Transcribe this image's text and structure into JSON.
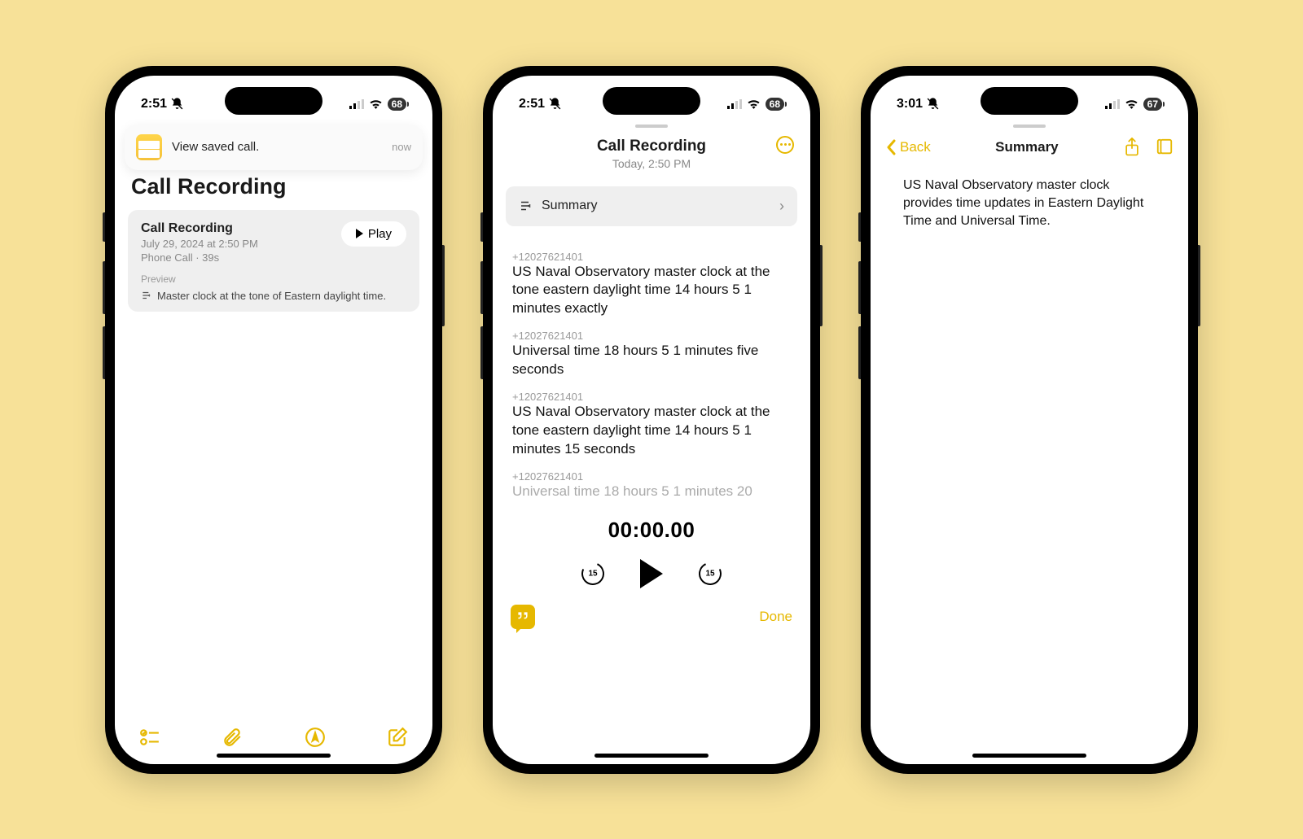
{
  "phone1": {
    "status": {
      "time": "2:51",
      "battery": "68"
    },
    "notification": {
      "text": "View saved call.",
      "time": "now"
    },
    "header": "Call Recording",
    "card": {
      "title": "Call Recording",
      "date": "July 29, 2024 at 2:50 PM",
      "details": "Phone Call · 39s",
      "play_label": "Play",
      "preview_label": "Preview",
      "preview_text": "Master clock at the tone of Eastern daylight time."
    }
  },
  "phone2": {
    "status": {
      "time": "2:51",
      "battery": "68"
    },
    "title": "Call Recording",
    "subtitle": "Today, 2:50 PM",
    "summary_label": "Summary",
    "caller_number": "+12027621401",
    "transcript": [
      {
        "text": "US Naval Observatory master clock at the tone eastern daylight time 14 hours 5 1 minutes exactly"
      },
      {
        "text": "Universal time 18 hours 5 1 minutes five seconds"
      },
      {
        "text": "US Naval Observatory master clock at the tone eastern daylight time 14 hours 5 1 minutes 15 seconds"
      },
      {
        "text": "Universal time 18 hours 5 1 minutes 20"
      }
    ],
    "player_time": "00:00.00",
    "skip_seconds": "15",
    "done_label": "Done"
  },
  "phone3": {
    "status": {
      "time": "3:01",
      "battery": "67"
    },
    "back_label": "Back",
    "title": "Summary",
    "body": "US Naval Observatory master clock provides time updates in Eastern Daylight Time and Universal Time."
  }
}
